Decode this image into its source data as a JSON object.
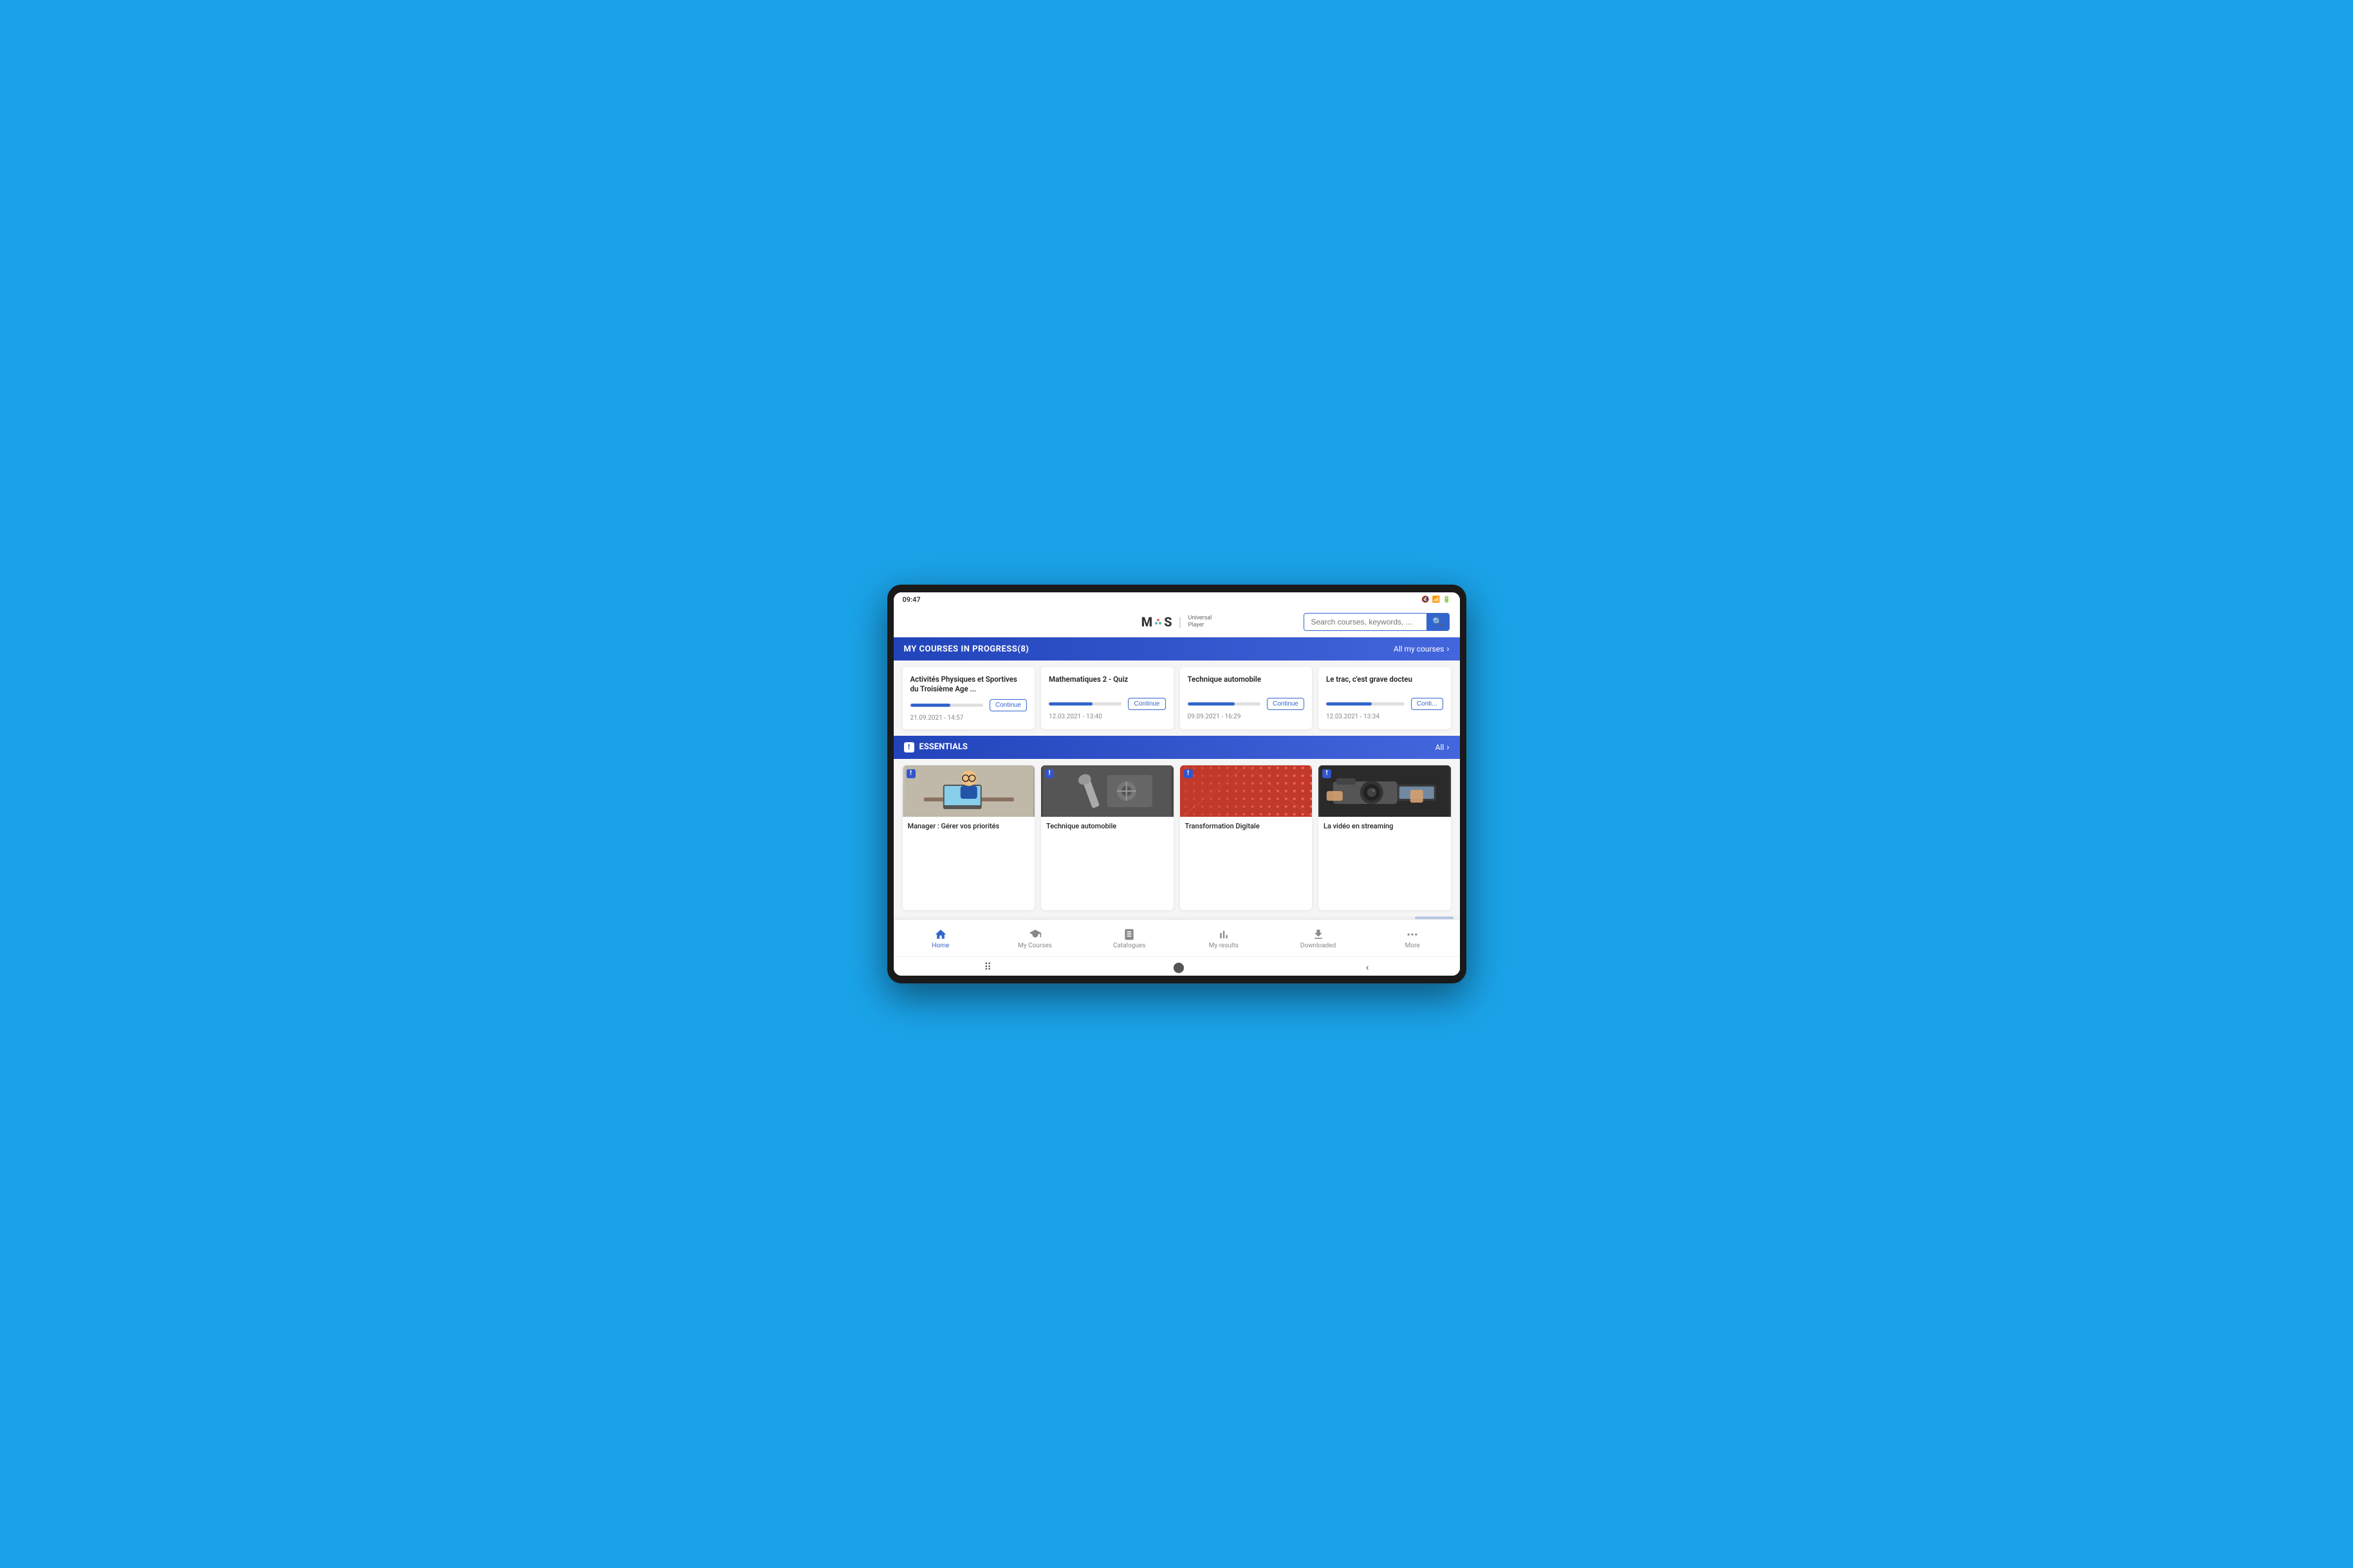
{
  "device": {
    "time": "09:47",
    "background_color": "#1aa3e8"
  },
  "header": {
    "logo_m": "M",
    "logo_dot": "·",
    "logo_s": "S",
    "logo_separator": "|",
    "logo_subtitle_line1": "Universal",
    "logo_subtitle_line2": "Player",
    "search_placeholder": "Search courses, keywords, ..."
  },
  "courses_section": {
    "title": "MY COURSES IN PROGRESS(8)",
    "link": "All my courses",
    "courses": [
      {
        "title": "Activités Physiques et Sportives du Troisième Age ...",
        "date": "21.09.2021 - 14:57",
        "progress": 55,
        "button": "Continue"
      },
      {
        "title": "Mathematiques 2 - Quiz",
        "date": "12.03.2021 - 13:40",
        "progress": 60,
        "button": "Continue"
      },
      {
        "title": "Technique automobile",
        "date": "09.09.2021 - 16:29",
        "progress": 65,
        "button": "Continue"
      },
      {
        "title": "Le trac, c'est grave docteu",
        "date": "12.03.2021 - 13:34",
        "progress": 58,
        "button": "Conti..."
      }
    ]
  },
  "essentials_section": {
    "title": "ESSENTIALS",
    "badge": "!",
    "link": "All",
    "items": [
      {
        "title": "Manager : Gérer vos priorités",
        "image_type": "manager"
      },
      {
        "title": "Technique automobile",
        "image_type": "auto"
      },
      {
        "title": "Transformation Digitale",
        "image_type": "digital"
      },
      {
        "title": "La vidéo en streaming",
        "image_type": "video"
      }
    ]
  },
  "bottom_nav": {
    "items": [
      {
        "label": "Home",
        "icon": "🏠",
        "active": true
      },
      {
        "label": "My Courses",
        "icon": "🎓",
        "active": false
      },
      {
        "label": "Catalogues",
        "icon": "📖",
        "active": false
      },
      {
        "label": "My results",
        "icon": "📊",
        "active": false
      },
      {
        "label": "Downloaded",
        "icon": "⬇",
        "active": false
      },
      {
        "label": "More",
        "icon": "···",
        "active": false
      }
    ]
  }
}
